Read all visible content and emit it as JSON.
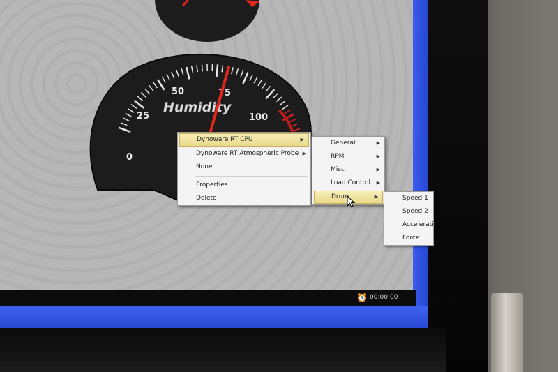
{
  "gauge": {
    "title": "Humidity",
    "tick_labels": [
      "0",
      "25",
      "50",
      "75",
      "100"
    ],
    "needle_value": 75
  },
  "context_menu": {
    "items": [
      {
        "label": "Dynoware RT CPU",
        "submenu": true,
        "highlighted": true
      },
      {
        "label": "Dynoware RT Atmospheric Probe",
        "submenu": true,
        "highlighted": false
      },
      {
        "label": "None",
        "submenu": false,
        "highlighted": false
      },
      {
        "label": "Properties",
        "submenu": false,
        "highlighted": false
      },
      {
        "label": "Delete",
        "submenu": false,
        "highlighted": false
      }
    ]
  },
  "submenu_cpu": {
    "items": [
      {
        "label": "General",
        "highlighted": false
      },
      {
        "label": "RPM",
        "highlighted": false
      },
      {
        "label": "Misc",
        "highlighted": false
      },
      {
        "label": "Load Control",
        "highlighted": false
      },
      {
        "label": "Drum",
        "highlighted": true
      }
    ]
  },
  "submenu_drum": {
    "items": [
      {
        "label": "Speed 1"
      },
      {
        "label": "Speed 2"
      },
      {
        "label": "Acceleratio"
      },
      {
        "label": "Force"
      }
    ]
  },
  "statusbar": {
    "timer": "00:00:00",
    "timer_icon": "alarm-clock-icon"
  },
  "colors": {
    "gauge_face": "#1c1c1c",
    "needle": "#e3261b",
    "menu_highlight": "#eddf94",
    "taskbar": "#2f55e0"
  }
}
